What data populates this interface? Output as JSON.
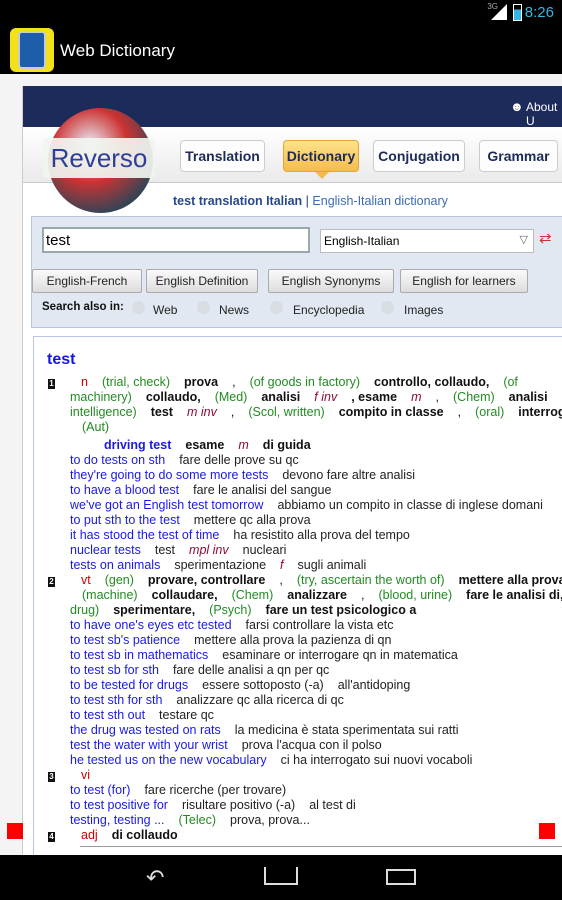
{
  "status": {
    "network": "3G",
    "time": "8:26"
  },
  "app": {
    "title": "Web Dictionary"
  },
  "site": {
    "about": "About U",
    "logo": "Reverso",
    "tabs": [
      "Translation",
      "Dictionary",
      "Conjugation",
      "Grammar"
    ],
    "active_tab": "Dictionary",
    "subtitle_bold": "test translation Italian",
    "subtitle_sep": " | ",
    "subtitle_link": "English-Italian dictionary",
    "search_value": "test",
    "language": "English-Italian",
    "buttons": [
      "English-French",
      "English Definition",
      "English Synonyms",
      "English for learners"
    ],
    "search_also_label": "Search also in:",
    "search_also": [
      "Web",
      "News",
      "Encyclopedia",
      "Images"
    ]
  },
  "colors": {
    "header": "#1c2b5a",
    "active_tab": "#f5bc4c",
    "example": "#1a1ae6",
    "label": "#228b22",
    "pos": "#cc0000"
  },
  "results": {
    "headword": "test",
    "lines": [
      {
        "i": 0,
        "s": [
          [
            "num",
            "1"
          ],
          [
            "pos",
            "n"
          ],
          [
            "g",
            "(trial, check)"
          ],
          [
            "k",
            "prova"
          ],
          [
            "t",
            ","
          ],
          [
            "g",
            "(of goods in factory)"
          ],
          [
            "k",
            "controllo, collaudo,"
          ],
          [
            "g",
            "(of"
          ]
        ]
      },
      {
        "i": 1,
        "s": [
          [
            "g",
            "machinery)"
          ],
          [
            "k",
            "collaudo,"
          ],
          [
            "g",
            "(Med)"
          ],
          [
            "k",
            "analisi"
          ],
          [
            "p",
            "f inv"
          ],
          [
            "k",
            ", esame"
          ],
          [
            "p",
            "m"
          ],
          [
            "t",
            ","
          ],
          [
            "g",
            "(Chem)"
          ],
          [
            "k",
            "analisi"
          ],
          [
            "t",
            ","
          ],
          [
            "g",
            "(ex"
          ]
        ]
      },
      {
        "i": 1,
        "s": [
          [
            "g",
            "intelligence)"
          ],
          [
            "k",
            "test"
          ],
          [
            "p",
            "m inv"
          ],
          [
            "t",
            ","
          ],
          [
            "g",
            "(Scol, written)"
          ],
          [
            "k",
            "compito in classe"
          ],
          [
            "t",
            ","
          ],
          [
            "g",
            "(oral)"
          ],
          [
            "k",
            "interrogazione"
          ]
        ]
      },
      {
        "i": 2,
        "s": [
          [
            "g",
            "(Aut)"
          ]
        ]
      },
      {
        "i": 3,
        "s": [
          [
            "ex",
            "driving test"
          ],
          [
            "k",
            "esame"
          ],
          [
            "p",
            "m"
          ],
          [
            "k",
            "di guida"
          ]
        ]
      },
      {
        "i": 1,
        "s": [
          [
            "e",
            "to do tests on sth"
          ],
          [
            "t",
            "fare delle prove su qc"
          ]
        ]
      },
      {
        "i": 1,
        "s": [
          [
            "e",
            "they're going to do some more tests"
          ],
          [
            "t",
            "devono fare altre analisi"
          ]
        ]
      },
      {
        "i": 1,
        "s": [
          [
            "e",
            "to have a blood test"
          ],
          [
            "t",
            "fare le analisi del sangue"
          ]
        ]
      },
      {
        "i": 1,
        "s": [
          [
            "e",
            "we've got an English test tomorrow"
          ],
          [
            "t",
            "abbiamo un compito in classe di inglese domani"
          ]
        ]
      },
      {
        "i": 1,
        "s": [
          [
            "e",
            "to put sth to the test"
          ],
          [
            "t",
            "mettere qc alla prova"
          ]
        ]
      },
      {
        "i": 1,
        "s": [
          [
            "e",
            "it has stood the test of time"
          ],
          [
            "t",
            "ha resistito alla prova del tempo"
          ]
        ]
      },
      {
        "i": 1,
        "s": [
          [
            "e",
            "nuclear tests"
          ],
          [
            "t",
            "test"
          ],
          [
            "p",
            "mpl inv"
          ],
          [
            "t",
            "nucleari"
          ]
        ]
      },
      {
        "i": 1,
        "s": [
          [
            "e",
            "tests on animals"
          ],
          [
            "t",
            "sperimentazione"
          ],
          [
            "p",
            "f"
          ],
          [
            "t",
            "sugli animali"
          ]
        ]
      },
      {
        "i": 0,
        "s": [
          [
            "num",
            "2"
          ],
          [
            "pos",
            "vt"
          ],
          [
            "g",
            "(gen)"
          ],
          [
            "k",
            "provare, controllare"
          ],
          [
            "t",
            ","
          ],
          [
            "g",
            "(try, ascertain the worth of)"
          ],
          [
            "k",
            "mettere alla prova"
          ]
        ]
      },
      {
        "i": 2,
        "s": [
          [
            "g",
            "(machine)"
          ],
          [
            "k",
            "collaudare,"
          ],
          [
            "g",
            "(Chem)"
          ],
          [
            "k",
            "analizzare"
          ],
          [
            "t",
            ","
          ],
          [
            "g",
            "(blood, urine)"
          ],
          [
            "k",
            "fare le analisi di,"
          ],
          [
            "g",
            "("
          ]
        ]
      },
      {
        "i": 1,
        "s": [
          [
            "g",
            "drug)"
          ],
          [
            "k",
            "sperimentare,"
          ],
          [
            "g",
            "(Psych)"
          ],
          [
            "k",
            "fare un test psicologico a"
          ]
        ]
      },
      {
        "i": 1,
        "s": [
          [
            "e",
            "to have one's eyes etc tested"
          ],
          [
            "t",
            "farsi controllare la vista etc"
          ]
        ]
      },
      {
        "i": 1,
        "s": [
          [
            "e",
            "to test sb's patience"
          ],
          [
            "t",
            "mettere alla prova la pazienza di qn"
          ]
        ]
      },
      {
        "i": 1,
        "s": [
          [
            "e",
            "to test sb in mathematics"
          ],
          [
            "t",
            "esaminare or interrogare qn in matematica"
          ]
        ]
      },
      {
        "i": 1,
        "s": [
          [
            "e",
            "to test sb for sth"
          ],
          [
            "t",
            "fare delle analisi a qn per qc"
          ]
        ]
      },
      {
        "i": 1,
        "s": [
          [
            "e",
            "to be tested for drugs"
          ],
          [
            "t",
            "essere sottoposto (-a)"
          ],
          [
            "t",
            "all'antidoping"
          ]
        ]
      },
      {
        "i": 1,
        "s": [
          [
            "e",
            "to test sth for sth"
          ],
          [
            "t",
            "analizzare qc alla ricerca di qc"
          ]
        ]
      },
      {
        "i": 1,
        "s": [
          [
            "e",
            "to test sth out"
          ],
          [
            "t",
            "testare qc"
          ]
        ]
      },
      {
        "i": 1,
        "s": [
          [
            "e",
            "the drug was tested on rats"
          ],
          [
            "t",
            "la medicina è stata sperimentata sui ratti"
          ]
        ]
      },
      {
        "i": 1,
        "s": [
          [
            "e",
            "test the water with your wrist"
          ],
          [
            "t",
            "prova l'acqua con il polso"
          ]
        ]
      },
      {
        "i": 1,
        "s": [
          [
            "e",
            "he tested us on the new vocabulary"
          ],
          [
            "t",
            "ci ha interrogato sui nuovi vocaboli"
          ]
        ]
      },
      {
        "i": 0,
        "s": [
          [
            "num",
            "3"
          ],
          [
            "pos",
            "vi"
          ]
        ]
      },
      {
        "i": 1,
        "s": [
          [
            "e",
            "to test (for)"
          ],
          [
            "t",
            "fare ricerche (per trovare)"
          ]
        ]
      },
      {
        "i": 1,
        "s": [
          [
            "e",
            "to test positive for"
          ],
          [
            "t",
            "risultare positivo (-a)"
          ],
          [
            "t",
            "al test di"
          ]
        ]
      },
      {
        "i": 1,
        "s": [
          [
            "e",
            "testing, testing ..."
          ],
          [
            "g",
            "(Telec)"
          ],
          [
            "t",
            "prova, prova..."
          ]
        ]
      },
      {
        "i": 0,
        "s": [
          [
            "num",
            "4"
          ],
          [
            "pos",
            "adj"
          ],
          [
            "k",
            "di collaudo"
          ]
        ]
      }
    ]
  },
  "navbar": {
    "back": "back-icon",
    "home": "home-icon",
    "recents": "recents-icon"
  }
}
